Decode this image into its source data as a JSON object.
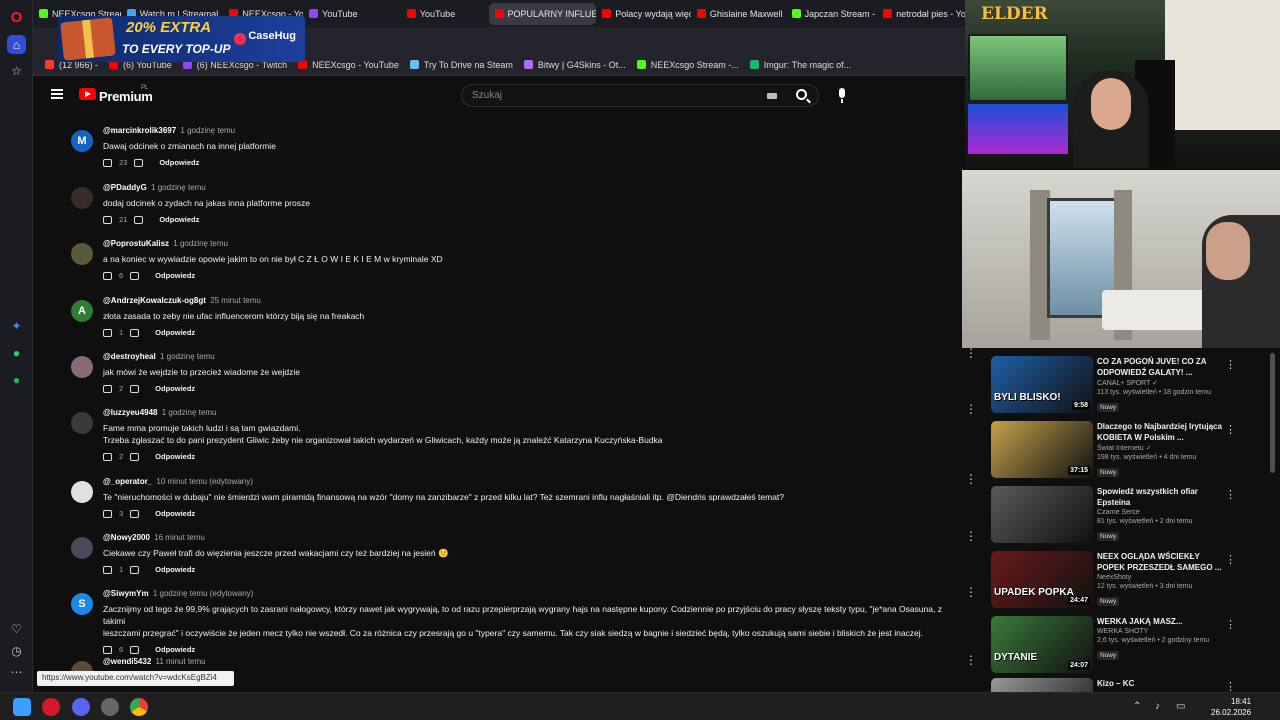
{
  "tabs": [
    {
      "label": "NEEXcsgo Stream",
      "color": "#53fc18",
      "active": false
    },
    {
      "label": "Watch m | Streamal",
      "color": "#3ea6ff",
      "active": false
    },
    {
      "label": "NEEXcsgo - YouTub",
      "color": "#ff0000",
      "active": false
    },
    {
      "label": "YouTube",
      "color": "#9146ff",
      "active": false
    },
    {
      "label": "YouTube",
      "color": "#ff0000",
      "active": false
    },
    {
      "label": "POPULARNY INFLUENCER",
      "color": "#ff0000",
      "active": true
    },
    {
      "label": "Polacy wydają więc",
      "color": "#ff0000",
      "active": false
    },
    {
      "label": "Ghislaine Maxwell",
      "color": "#ff0000",
      "active": false
    },
    {
      "label": "Japczan Stream - V",
      "color": "#53fc18",
      "active": false
    },
    {
      "label": "netrodal pies - You",
      "color": "#ff0000",
      "active": false
    }
  ],
  "ad": {
    "line1": "20% EXTRA",
    "line2": "TO EVERY TOP-UP",
    "brand": "CaseHug"
  },
  "bookmarks": [
    {
      "label": "(12 966) -",
      "color": "#ff3b30"
    },
    {
      "label": "(6) YouTube",
      "color": "#ff0000"
    },
    {
      "label": "(6) NEEXcsgo - Twitch",
      "color": "#9146ff"
    },
    {
      "label": "NEEXcsgo - YouTube",
      "color": "#ff0000"
    },
    {
      "label": "Try To Drive na Steam",
      "color": "#66c0f4"
    },
    {
      "label": "Bitwy | G4Skins - Ot...",
      "color": "#b36bff"
    },
    {
      "label": "NEEXcsgo Stream -...",
      "color": "#53fc18"
    },
    {
      "label": "Imgur: The magic of...",
      "color": "#1bb76e"
    }
  ],
  "header": {
    "brand": "Premium",
    "region": "PL",
    "search_placeholder": "Szukaj"
  },
  "comments": [
    {
      "avatar_letter": "M",
      "avatar_color": "#1565c0",
      "author": "@marcinkrolik3697",
      "time": "1 godzinę temu",
      "lines": [
        "Dawaj odcinek o zmianach na innej platformie"
      ],
      "likes": "23",
      "reply": "Odpowiedz"
    },
    {
      "avatar_letter": "",
      "avatar_color": "#3b2a2a",
      "author": "@PDaddyG",
      "time": "1 godzinę temu",
      "lines": [
        "dodaj odcinek o zydach na jakas inna platforme prosze"
      ],
      "likes": "21",
      "reply": "Odpowiedz"
    },
    {
      "avatar_letter": "",
      "avatar_color": "#5a5a3a",
      "author": "@PoprostuKalisz",
      "time": "1 godzinę temu",
      "lines": [
        "a na koniec w wywiadzie opowie jakim  to on nie był C Z Ł O W I E K I E M w kryminale XD"
      ],
      "likes": "6",
      "reply": "Odpowiedz"
    },
    {
      "avatar_letter": "A",
      "avatar_color": "#2e7d32",
      "author": "@AndrzejKowalczuk-og8gt",
      "time": "25 minut temu",
      "lines": [
        "złota zasada to zeby nie ufac influencerom którzy biją się na freakach"
      ],
      "likes": "1",
      "reply": "Odpowiedz"
    },
    {
      "avatar_letter": "",
      "avatar_color": "#8a6a7a",
      "author": "@destroyheal",
      "time": "1 godzinę temu",
      "lines": [
        "jak mówi że wejdzie to przecież wiadome że wejdzie"
      ],
      "likes": "2",
      "reply": "Odpowiedz"
    },
    {
      "avatar_letter": "",
      "avatar_color": "#3a3a3a",
      "author": "@luzzyeu4948",
      "time": "1 godzinę temu",
      "lines": [
        "Fame mma promuje takich ludzi i są tam gwiazdami.",
        "Trzeba zgłaszać to do pani prezydent Gliwic żeby nie organizował takich wydarzeń w Gliwicach, każdy może ją znaleźć Katarzyna Kuczyńska-Budka"
      ],
      "likes": "2",
      "reply": "Odpowiedz"
    },
    {
      "avatar_letter": "",
      "avatar_color": "#e0e0e0",
      "author": "@_operator_",
      "time": "10 minut temu (edytowany)",
      "lines": [
        "Te \"nieruchomości w dubaju\" nie śmierdzi wam piramidą finansową na wzór \"domy na zanzibarze\" z przed kilku lat? Też szemrani influ nagłaśniali itp. @Diendris sprawdzałeś temat?"
      ],
      "likes": "3",
      "reply": "Odpowiedz"
    },
    {
      "avatar_letter": "",
      "avatar_color": "#4a4a5a",
      "author": "@Nowy2000",
      "time": "16 minut temu",
      "lines": [
        "Ciekawe czy Paweł trafi do więzienia jeszcze przed wakacjami czy też bardziej na jesień 🙂"
      ],
      "likes": "1",
      "reply": "Odpowiedz"
    },
    {
      "avatar_letter": "S",
      "avatar_color": "#1e88e5",
      "author": "@SiwymYm",
      "time": "1 godzinę temu (edytowany)",
      "lines": [
        "Zacznijmy od tego że 99,9% grających to zasrani nałogowcy, którzy nawet jak wygrywają, to od razu przepierprzają wygrany hajs na następne kupony. Codziennie po przyjściu do pracy słyszę teksty typu, \"je*ana Osasuna, z takimi",
        "leszczami przegrać\"  i oczywiście że jeden mecz tylko nie wszedł. Co za różnica czy przesrają go u \"typera\" czy samemu. Tak czy siak siedzą w bagnie i siedzieć będą, tylko oszukują sami siebie i bliskich że jest inaczej."
      ],
      "likes": "6",
      "reply": "Odpowiedz"
    },
    {
      "avatar_letter": "",
      "avatar_color": "#5a4a3a",
      "author": "@wendi5432",
      "time": "11 minut temu",
      "lines": [
        ""
      ],
      "likes": "",
      "reply": ""
    }
  ],
  "status_url": "https://www.youtube.com/watch?v=wdcKsEgBZi4",
  "stream_logo": "ELDER",
  "recommendations": [
    {
      "title": "CO ZA POGOŃ JUVE! CO ZA ODPOWIEDŹ GALATY! ...",
      "channel": "CANAL+ SPORT ✓",
      "stats": "113 tys. wyświetleń • 18 godzin temu",
      "badge": "Nowy",
      "duration": "9:58",
      "thumb_text": "BYLI BLISKO!",
      "thumb_color": "#1d5fa8"
    },
    {
      "title": "Dlaczego to Najbardziej Irytująca KOBIETA W Polskim ...",
      "channel": "Świat Internetu ✓",
      "stats": "198 tys. wyświetleń • 4 dni temu",
      "badge": "Nowy",
      "duration": "37:15",
      "thumb_text": "",
      "thumb_color": "#c7a24a"
    },
    {
      "title": "Spowiedź wszystkich ofiar Epsteina",
      "channel": "Czarne Serce",
      "stats": "81 tys. wyświetleń • 2 dni temu",
      "badge": "Nowy",
      "duration": "",
      "thumb_text": "",
      "thumb_color": "#5a5a5a"
    },
    {
      "title": "NEEX OGLĄDA WŚCIEKŁY POPEK PRZESZEDŁ SAMEGO ...",
      "channel": "NeexShoty",
      "stats": "12 tys. wyświetleń • 3 dni temu",
      "badge": "Nowy",
      "duration": "24:47",
      "thumb_text": "UPADEK POPKA",
      "thumb_color": "#6a1a1a"
    },
    {
      "title": "WERKA JAKĄ MASZ...",
      "channel": "WERKA SHOTY",
      "stats": "2,6 tys. wyświetleń • 2 godziny temu",
      "badge": "Nowy",
      "duration": "24:07",
      "thumb_text": "DYTANIE",
      "thumb_color": "#3a7a3a"
    },
    {
      "title": "Kizo – KC",
      "channel": "",
      "stats": "",
      "badge": "",
      "duration": "",
      "thumb_text": "",
      "thumb_color": "#999999"
    }
  ],
  "clock": {
    "time": "18:41",
    "date": "26.02.2026"
  }
}
